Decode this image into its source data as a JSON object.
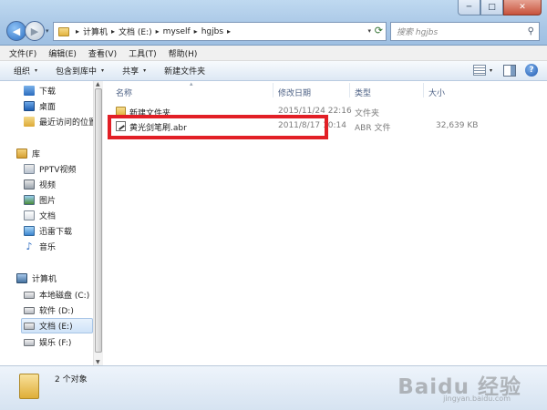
{
  "titlebar": {
    "caption_buttons": [
      "─",
      "□",
      "✕"
    ]
  },
  "navigation": {
    "back_glyph": "◀",
    "forward_glyph": "▶",
    "recent_glyph": "▾"
  },
  "address": {
    "crumbs": [
      "计算机",
      "文档 (E:)",
      "myself",
      "hgjbs"
    ],
    "separator": "▸",
    "dropdown_glyph": "▾",
    "refresh_glyph": "⟳"
  },
  "search": {
    "placeholder": "搜索 hgjbs",
    "icon_glyph": "⚲"
  },
  "menu": [
    "文件(F)",
    "编辑(E)",
    "查看(V)",
    "工具(T)",
    "帮助(H)"
  ],
  "toolbar": {
    "organize": "组织",
    "include_in_library": "包含到库中",
    "share": "共享",
    "new_folder": "新建文件夹",
    "dropdown_glyph": "▾",
    "help_glyph": "?"
  },
  "sidebar": {
    "items": [
      {
        "label": "下载",
        "icon": "download-icon",
        "indent": true
      },
      {
        "label": "桌面",
        "icon": "desktop-icon",
        "indent": true
      },
      {
        "label": "最近访问的位置",
        "icon": "recent-places-icon",
        "indent": true
      },
      {
        "label": "库",
        "icon": "library-icon",
        "indent": false
      },
      {
        "label": "PPTV视频",
        "icon": "pptv-video-icon",
        "indent": true
      },
      {
        "label": "视频",
        "icon": "video-icon",
        "indent": true
      },
      {
        "label": "图片",
        "icon": "pictures-icon",
        "indent": true
      },
      {
        "label": "文档",
        "icon": "documents-icon",
        "indent": true
      },
      {
        "label": "迅雷下载",
        "icon": "xunlei-download-icon",
        "indent": true
      },
      {
        "label": "音乐",
        "icon": "music-icon",
        "indent": true
      },
      {
        "label": "计算机",
        "icon": "computer-icon",
        "indent": false
      },
      {
        "label": "本地磁盘 (C:)",
        "icon": "drive-icon",
        "indent": true
      },
      {
        "label": "软件 (D:)",
        "icon": "drive-icon",
        "indent": true
      },
      {
        "label": "文档 (E:)",
        "icon": "drive-icon",
        "indent": true,
        "selected": true
      },
      {
        "label": "娱乐 (F:)",
        "icon": "drive-icon",
        "indent": true
      }
    ],
    "scroll_up_glyph": "▲",
    "scroll_down_glyph": "▼"
  },
  "file_list": {
    "columns": [
      "名称",
      "修改日期",
      "类型",
      "大小"
    ],
    "sort_glyph": "▴",
    "rows": [
      {
        "name": "新建文件夹",
        "modified": "2015/11/24 22:16",
        "type": "文件夹",
        "size": "",
        "icon": "folder-icon"
      },
      {
        "name": "黄光剑笔刷.abr",
        "modified": "2011/8/17 10:14",
        "type": "ABR 文件",
        "size": "32,639 KB",
        "icon": "abr-file-icon"
      }
    ]
  },
  "status": {
    "count_text": "2 个对象"
  },
  "watermark": {
    "text": "Baidu 经验",
    "subtext": "jingyan.baidu.com"
  },
  "colors": {
    "highlight_box": "#e21f26",
    "column_header": "#4d6185"
  }
}
